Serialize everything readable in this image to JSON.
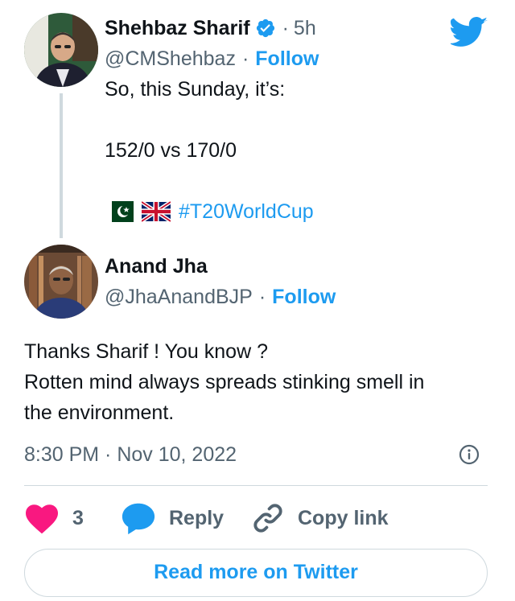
{
  "parent_tweet": {
    "author_name": "Shehbaz Sharif",
    "time_sep": "·",
    "time_ago": "5h",
    "handle": "@CMShehbaz",
    "follow_sep": "·",
    "follow_label": "Follow",
    "text_line1": "So, this Sunday, it’s:",
    "text_line2": "152/0 vs 170/0",
    "hashtag": "#T20WorldCup",
    "verified": true
  },
  "reply_tweet": {
    "author_name": "Anand Jha",
    "handle": "@JhaAnandBJP",
    "follow_sep": "·",
    "follow_label": "Follow",
    "text_line1": "Thanks Sharif ! You know ?",
    "text_line2": "Rotten mind always spreads stinking smell in",
    "text_line3": "the environment.",
    "timestamp": "8:30 PM · Nov 10, 2022"
  },
  "actions": {
    "like_count": "3",
    "reply_label": "Reply",
    "copy_label": "Copy link"
  },
  "read_more_label": "Read more on Twitter",
  "colors": {
    "accent": "#1d9bf0",
    "like": "#f91880",
    "muted": "#536471",
    "divider": "#cfd9de"
  },
  "icons": [
    "twitter-bird-icon",
    "verified-badge-icon",
    "pakistan-flag-icon",
    "uk-flag-icon",
    "info-icon",
    "heart-icon",
    "reply-bubble-icon",
    "link-icon"
  ]
}
